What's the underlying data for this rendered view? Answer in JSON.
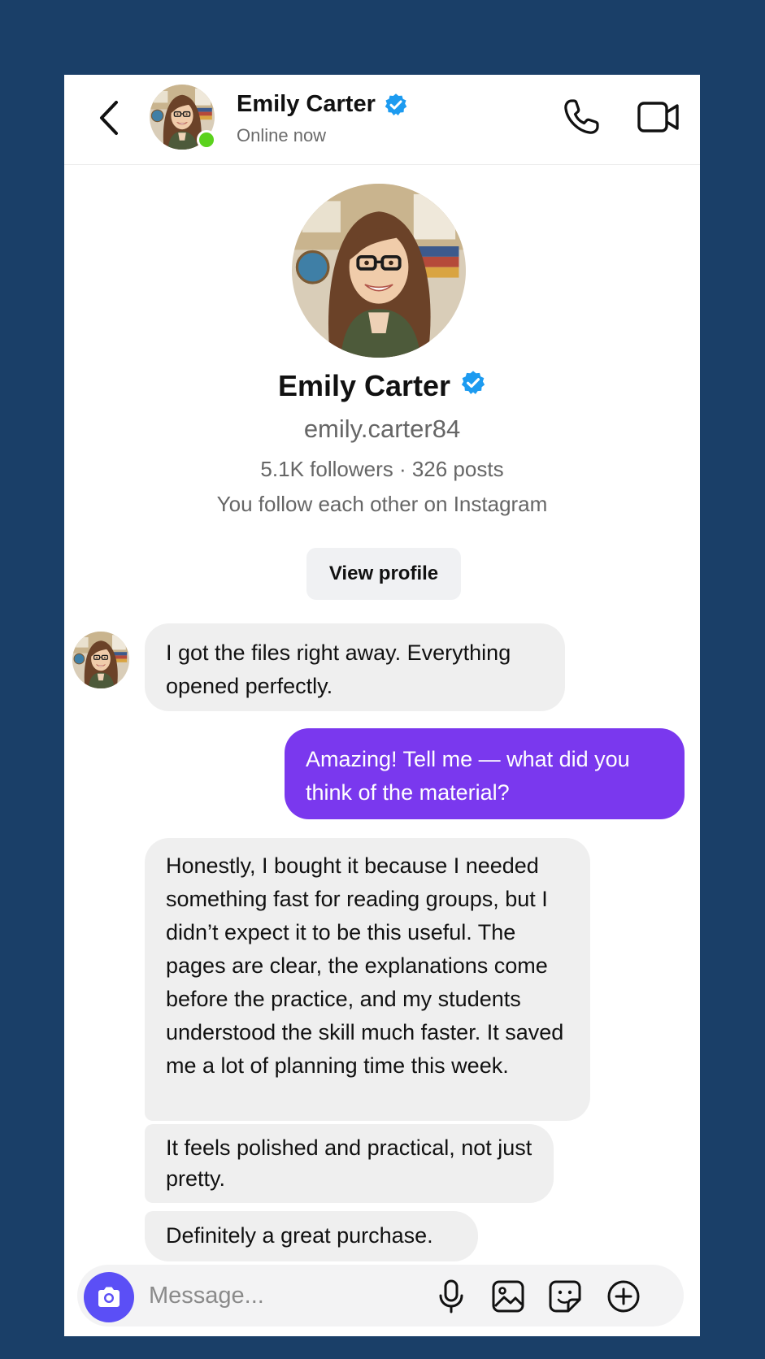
{
  "header": {
    "name": "Emily Carter",
    "status": "Online now",
    "verified": true,
    "online_color": "#5bd21d"
  },
  "profile": {
    "name": "Emily Carter",
    "handle": "emily.carter84",
    "stats": "5.1K followers · 326 posts",
    "mutual": "You follow each other on Instagram",
    "view_profile_label": "View profile"
  },
  "messages": [
    {
      "sender": "them",
      "text": "I got the files right away. Everything opened perfectly."
    },
    {
      "sender": "me",
      "text": "Amazing! Tell me — what did you think of the material?"
    },
    {
      "sender": "them",
      "text": "Honestly, I bought it because I needed something fast for reading groups, but I didn’t expect it to be this useful. The pages are clear, the explanations come before the practice, and my students understood the skill much faster. It saved me a lot of planning time this week."
    },
    {
      "sender": "them",
      "text": "It feels polished and practical, not just pretty."
    },
    {
      "sender": "them",
      "text": "Definitely a great purchase."
    }
  ],
  "composer": {
    "placeholder": "Message..."
  },
  "colors": {
    "background": "#1a3f68",
    "outgoing_bubble": "#7a38ee",
    "incoming_bubble": "#efefef",
    "camera_button": "#5b4ff6",
    "verified_badge": "#1d9bf0"
  },
  "icons": {
    "back": "chevron-left-icon",
    "call": "phone-icon",
    "video": "video-camera-icon",
    "camera": "camera-icon",
    "mic": "microphone-icon",
    "gallery": "image-icon",
    "sticker": "sticker-icon",
    "add": "plus-circle-icon"
  }
}
